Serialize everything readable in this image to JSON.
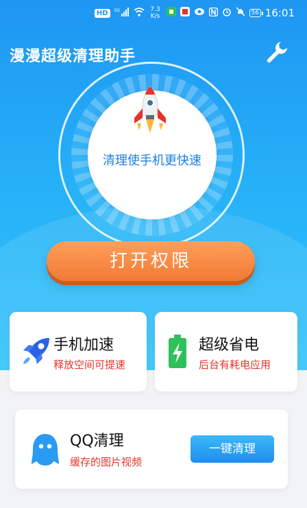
{
  "status_bar": {
    "time": "16:01",
    "hd_badge": "HD",
    "signal_label": "5G",
    "net_speed": "7.3 K/s",
    "battery_level": "56",
    "icons": [
      "hd-icon",
      "signal-icon",
      "wifi-icon",
      "app-icon",
      "app-icon",
      "eye-icon",
      "nfc-icon",
      "alarm-icon",
      "mute-icon",
      "battery-icon"
    ]
  },
  "header": {
    "title": "漫漫超级清理助手",
    "settings_icon": "wrench-icon"
  },
  "dial": {
    "caption": "清理使手机更快速",
    "icon": "rocket-icon"
  },
  "primary_button": {
    "label": "打开权限"
  },
  "cards": {
    "speed": {
      "title": "手机加速",
      "subtitle": "释放空间可提速",
      "icon": "rocket-icon"
    },
    "power": {
      "title": "超级省电",
      "subtitle": "后台有耗电应用",
      "icon": "battery-charging-icon"
    },
    "qq": {
      "title": "QQ清理",
      "subtitle": "缓存的图片视频",
      "button": "一键清理",
      "icon": "qq-icon"
    }
  },
  "colors": {
    "brand_blue": "#1e96f3",
    "accent_orange": "#f07a34",
    "subtitle_red": "#e5342c",
    "battery_green": "#2fbf5b"
  }
}
